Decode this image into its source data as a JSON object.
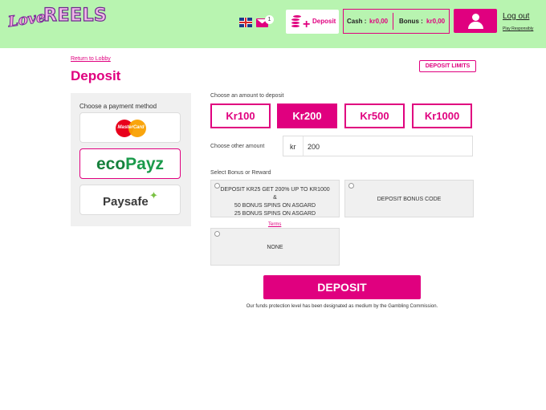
{
  "header": {
    "logo_love": "Love",
    "logo_reels": "REELS",
    "flag_icon": "uk-flag-icon",
    "mail_icon": "envelope-icon",
    "mail_count": "1",
    "deposit_label": "Deposit",
    "deposit_icon": "coins-plus-icon",
    "cash_label": "Cash :",
    "cash_value": "kr0,00",
    "bonus_label": "Bonus :",
    "bonus_value": "kr0,00",
    "user_icon": "user-icon",
    "logout": "Log out",
    "play_responsibly": "Play Responsibly"
  },
  "main": {
    "return_link": "Return to Lobby",
    "title": "Deposit",
    "deposit_limits": "DEPOSIT LIMITS",
    "payment_title": "Choose a payment method",
    "payment_methods": [
      {
        "name": "MasterCard",
        "selected": false
      },
      {
        "name_a": "eco",
        "name_b": "Payz",
        "selected": true
      },
      {
        "name": "Paysafe",
        "selected": false
      }
    ],
    "amount_label": "Choose an amount to deposit",
    "amounts": [
      "Kr100",
      "Kr200",
      "Kr500",
      "Kr1000"
    ],
    "selected_amount_index": 1,
    "other_label": "Choose other amount",
    "currency": "kr",
    "other_value": "200",
    "bonus_label": "Select Bonus or Reward",
    "bonus_options": [
      {
        "lines": [
          "DEPOSIT KR25 GET 200% UP TO KR1000",
          "&",
          "50 BONUS SPINS ON ASGARD",
          "25 BONUS SPINS ON ASGARD"
        ]
      },
      {
        "lines": [
          "DEPOSIT BONUS CODE"
        ]
      },
      {
        "lines": [
          "NONE"
        ]
      }
    ],
    "terms": "Terms",
    "deposit_button": "DEPOSIT",
    "funds_note": "Our funds protection level has been designated as medium by the Gambling Commission."
  },
  "colors": {
    "accent": "#e0007f",
    "header_bg": "#b8f4b0",
    "panel_bg": "#f0f0f0"
  }
}
